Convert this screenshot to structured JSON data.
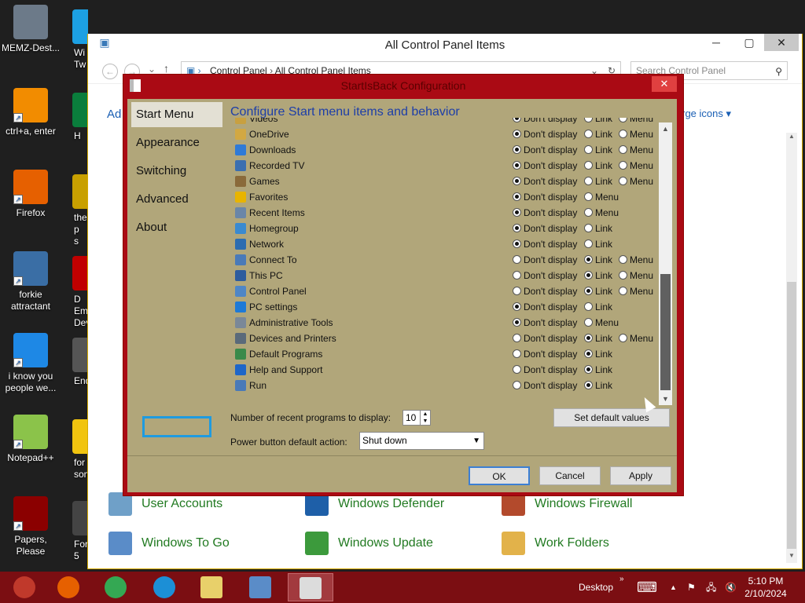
{
  "desktop": {
    "icons": [
      {
        "label": "MEMZ-Dest...",
        "color": "#6c7a89"
      },
      {
        "label": "ctrl+a, enter",
        "color": "#f28c00"
      },
      {
        "label": "Firefox",
        "color": "#e66000"
      },
      {
        "label": "forkie\nattractant",
        "color": "#3a6ea5"
      },
      {
        "label": "i know you\npeople we...",
        "color": "#1e88e5"
      },
      {
        "label": "Notepad++",
        "color": "#8bc34a"
      },
      {
        "label": "Papers, Please",
        "color": "#8b0000"
      }
    ],
    "icons2": [
      {
        "label": "Wi\nTw",
        "color": "#1ca0e3"
      },
      {
        "label": "H",
        "color": "#0a7d3c"
      },
      {
        "label": "the p\ns",
        "color": "#c8a000"
      },
      {
        "label": "D\nEmba\nDev",
        "color": "#c00000"
      },
      {
        "label": "Ender",
        "color": "#555"
      },
      {
        "label": "for\nsome",
        "color": "#f1c40f"
      },
      {
        "label": "Forza\n5",
        "color": "#444"
      }
    ]
  },
  "control_panel": {
    "title": "All Control Panel Items",
    "address": [
      "Control Panel",
      "All Control Panel Items"
    ],
    "search_placeholder": "Search Control Panel",
    "left_partial": "Ad",
    "view_by_partial": "rge icons",
    "items": [
      {
        "label": "User Accounts",
        "color": "#6fa0c8"
      },
      {
        "label": "Windows Defender",
        "color": "#1e5fa8"
      },
      {
        "label": "Windows Firewall",
        "color": "#b34a2c"
      },
      {
        "label": "Windows To Go",
        "color": "#5a8cc8"
      },
      {
        "label": "Windows Update",
        "color": "#3c9a3c"
      },
      {
        "label": "Work Folders",
        "color": "#e2b24a"
      }
    ]
  },
  "dialog": {
    "title": "StartIsBack Configuration",
    "side": [
      "Start Menu",
      "Appearance",
      "Switching",
      "Advanced",
      "About"
    ],
    "heading": "Configure Start menu items and behavior",
    "rows": [
      {
        "name": "Videos",
        "opts": [
          [
            "Don't display",
            true
          ],
          [
            "Link",
            false
          ],
          [
            "Menu",
            false
          ]
        ],
        "color": "#c8a040"
      },
      {
        "name": "OneDrive",
        "opts": [
          [
            "Don't display",
            true
          ],
          [
            "Link",
            false
          ],
          [
            "Menu",
            false
          ]
        ],
        "color": "#d2a842"
      },
      {
        "name": "Downloads",
        "opts": [
          [
            "Don't display",
            true
          ],
          [
            "Link",
            false
          ],
          [
            "Menu",
            false
          ]
        ],
        "color": "#2f7ad6"
      },
      {
        "name": "Recorded TV",
        "opts": [
          [
            "Don't display",
            true
          ],
          [
            "Link",
            false
          ],
          [
            "Menu",
            false
          ]
        ],
        "color": "#3b6fb0"
      },
      {
        "name": "Games",
        "opts": [
          [
            "Don't display",
            true
          ],
          [
            "Link",
            false
          ],
          [
            "Menu",
            false
          ]
        ],
        "color": "#8a6a3a"
      },
      {
        "name": "Favorites",
        "opts": [
          [
            "Don't display",
            true
          ],
          [
            "Menu",
            false
          ]
        ],
        "color": "#e8b400"
      },
      {
        "name": "Recent Items",
        "opts": [
          [
            "Don't display",
            true
          ],
          [
            "Menu",
            false
          ]
        ],
        "color": "#6a86a8"
      },
      {
        "name": "Homegroup",
        "opts": [
          [
            "Don't display",
            true
          ],
          [
            "Link",
            false
          ]
        ],
        "color": "#3a8ad0"
      },
      {
        "name": "Network",
        "opts": [
          [
            "Don't display",
            true
          ],
          [
            "Link",
            false
          ]
        ],
        "color": "#2c6cb0"
      },
      {
        "name": "Connect To",
        "opts": [
          [
            "Don't display",
            false
          ],
          [
            "Link",
            true
          ],
          [
            "Menu",
            false
          ]
        ],
        "color": "#4a7ab8"
      },
      {
        "name": "This PC",
        "opts": [
          [
            "Don't display",
            false
          ],
          [
            "Link",
            true
          ],
          [
            "Menu",
            false
          ]
        ],
        "color": "#2d5c9e"
      },
      {
        "name": "Control Panel",
        "opts": [
          [
            "Don't display",
            false
          ],
          [
            "Link",
            true
          ],
          [
            "Menu",
            false
          ]
        ],
        "color": "#4e86c6"
      },
      {
        "name": "PC settings",
        "opts": [
          [
            "Don't display",
            true
          ],
          [
            "Link",
            false
          ]
        ],
        "color": "#1e7ad6"
      },
      {
        "name": "Administrative Tools",
        "opts": [
          [
            "Don't display",
            true
          ],
          [
            "Menu",
            false
          ]
        ],
        "color": "#7a8898"
      },
      {
        "name": "Devices and Printers",
        "opts": [
          [
            "Don't display",
            false
          ],
          [
            "Link",
            true
          ],
          [
            "Menu",
            false
          ]
        ],
        "color": "#5a6a7a"
      },
      {
        "name": "Default Programs",
        "opts": [
          [
            "Don't display",
            false
          ],
          [
            "Link",
            true
          ]
        ],
        "color": "#3a8a4a"
      },
      {
        "name": "Help and Support",
        "opts": [
          [
            "Don't display",
            false
          ],
          [
            "Link",
            true
          ]
        ],
        "color": "#1e66c8"
      },
      {
        "name": "Run",
        "opts": [
          [
            "Don't display",
            false
          ],
          [
            "Link",
            true
          ]
        ],
        "color": "#4a7ab8"
      }
    ],
    "recent_label": "Number of recent programs to display:",
    "recent_value": "10",
    "set_default": "Set default values",
    "power_label": "Power button default action:",
    "power_value": "Shut down",
    "ok": "OK",
    "cancel": "Cancel",
    "apply": "Apply"
  },
  "taskbar": {
    "apps": [
      {
        "name": "start",
        "color": "#c0392b"
      },
      {
        "name": "firefox",
        "color": "#e66000"
      },
      {
        "name": "chrome",
        "color": "#34a853"
      },
      {
        "name": "edge",
        "color": "#1c8fd6"
      },
      {
        "name": "user-chat",
        "color": "#e8d06a"
      },
      {
        "name": "control-panel",
        "color": "#5a8cc8"
      },
      {
        "name": "startisback",
        "color": "#dcdcdc"
      }
    ],
    "desktop_label": "Desktop",
    "time": "5:10 PM",
    "date": "2/10/2024"
  }
}
